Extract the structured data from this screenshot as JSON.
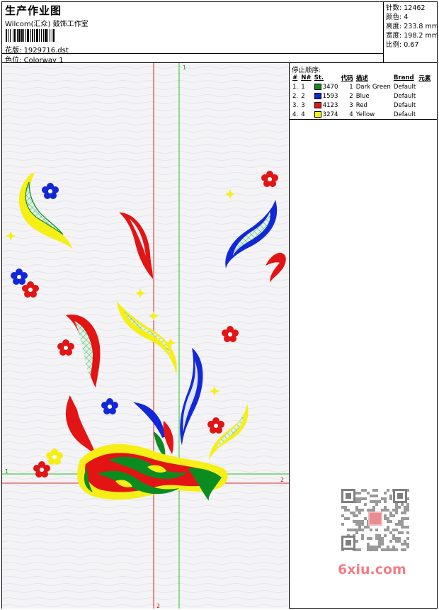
{
  "header": {
    "title": "生产作业图",
    "company": "Wilcom(汇众) 鼓饰工作室",
    "design_label": "花版:",
    "design_value": "1929716.dst",
    "colorway_label": "色位:",
    "colorway_value": "Colorway 1"
  },
  "stats": [
    {
      "label": "针数:",
      "value": "12462"
    },
    {
      "label": "颜色:",
      "value": "4"
    },
    {
      "label": "高度:",
      "value": "233.8 mm"
    },
    {
      "label": "宽度:",
      "value": "198.2 mm"
    },
    {
      "label": "比例:",
      "value": "0.67"
    }
  ],
  "stop_sequence": {
    "title": "停止顺序:",
    "columns": [
      "#",
      "N#",
      "St.",
      "代码",
      "描述",
      "Brand",
      "元素"
    ],
    "rows": [
      {
        "index": "1.",
        "n": "1",
        "color": "#0a8c21",
        "st": "3470",
        "code": "1",
        "desc": "Dark Green",
        "brand": "Default"
      },
      {
        "index": "2.",
        "n": "2",
        "color": "#1228d8",
        "st": "1593",
        "code": "2",
        "desc": "Blue",
        "brand": "Default"
      },
      {
        "index": "3.",
        "n": "3",
        "color": "#e31414",
        "st": "4123",
        "code": "3",
        "desc": "Red",
        "brand": "Default"
      },
      {
        "index": "4.",
        "n": "4",
        "color": "#f6ef16",
        "st": "3274",
        "code": "4",
        "desc": "Yellow",
        "brand": "Default"
      }
    ]
  },
  "markers": {
    "green_top": "1",
    "green_left": "1",
    "red_right": "2",
    "red_bottom": "2"
  },
  "colors": {
    "green": "#0a8c21",
    "blue": "#1228d8",
    "red": "#e31414",
    "yellow": "#f6ef16",
    "guide_red": "#e02020",
    "guide_green": "#20c020",
    "watermark": "#f07f86"
  },
  "watermark": {
    "site": "6xiu.com"
  }
}
